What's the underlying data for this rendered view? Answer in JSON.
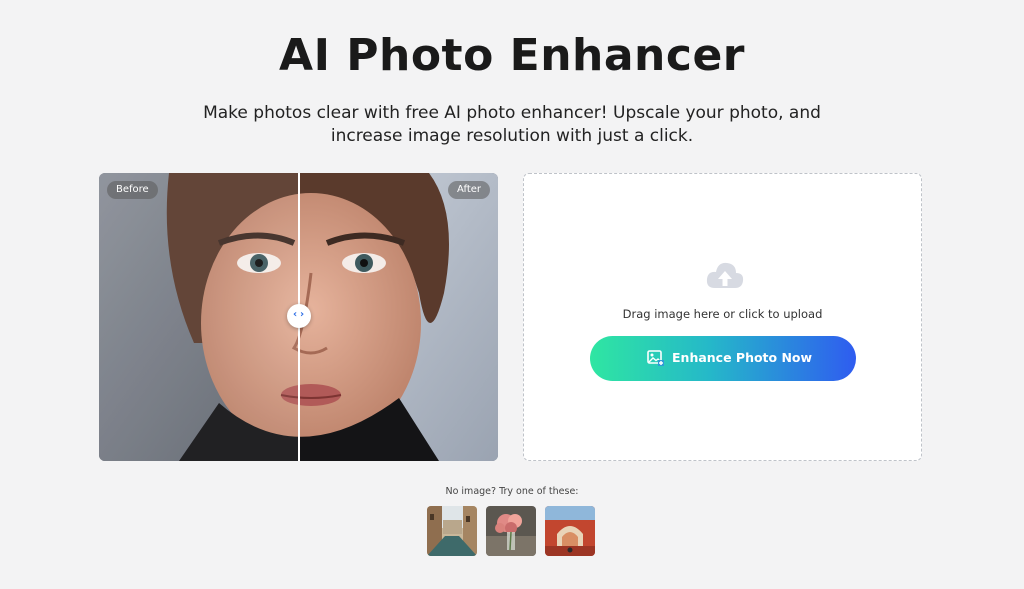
{
  "header": {
    "title": "AI Photo Enhancer",
    "subtitle_line1": "Make photos clear with free AI photo enhancer! Upscale your photo, and",
    "subtitle_line2": "increase image resolution with just a click."
  },
  "compare": {
    "before_label": "Before",
    "after_label": "After",
    "handle_left": "‹",
    "handle_right": "›"
  },
  "upload": {
    "icon": "cloud-upload-icon",
    "drag_text": "Drag image here or click to upload",
    "button_label": "Enhance Photo Now",
    "button_icon": "image-add-icon"
  },
  "samples": {
    "label": "No image? Try one of these:",
    "items": [
      "venice-canal-thumbnail",
      "pink-flowers-thumbnail",
      "red-archway-thumbnail"
    ]
  },
  "colors": {
    "background": "#f3f3f4",
    "button_gradient_start": "#2fe6a2",
    "button_gradient_end": "#2f5cf0",
    "handle_arrow": "#2f6fe6"
  }
}
